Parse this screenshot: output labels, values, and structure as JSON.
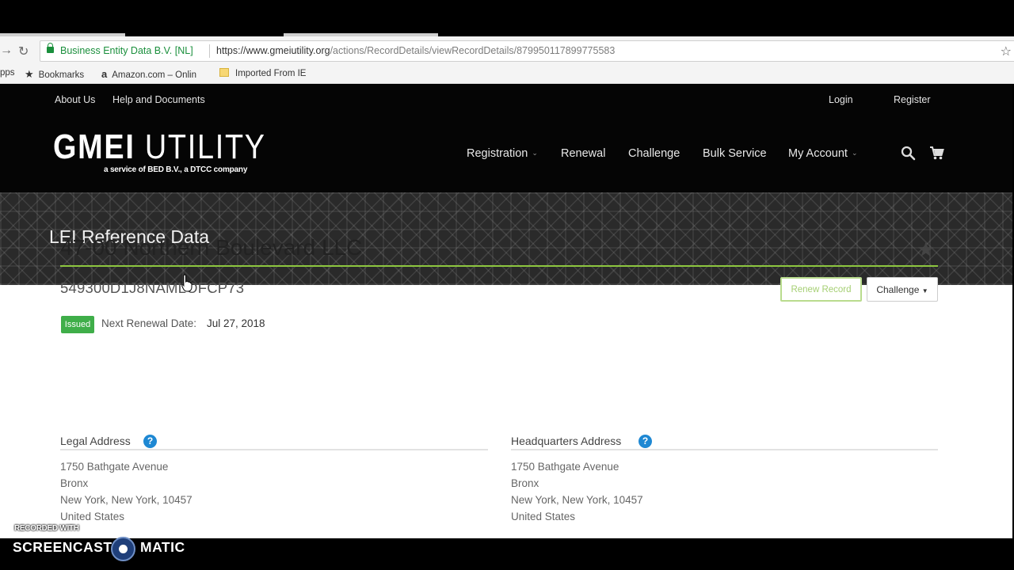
{
  "browser": {
    "omnibox": {
      "org": "Business Entity Data B.V. [NL]",
      "url_host": "https://www.gmeiutility.org",
      "url_path": "/actions/RecordDetails/viewRecordDetails/879950117899775583"
    },
    "bookmarks": [
      "pps",
      "Bookmarks",
      "Amazon.com – Onlin",
      "Imported From IE"
    ]
  },
  "site": {
    "util_links": {
      "about": "About Us",
      "help": "Help and Documents",
      "login": "Login",
      "register": "Register"
    },
    "logo": {
      "bold": "GMEI",
      "light": "UTILITY",
      "subtitle": "a service of BED B.V., a DTCC company"
    },
    "nav": {
      "registration": "Registration",
      "renewal": "Renewal",
      "challenge": "Challenge",
      "bulk": "Bulk Service",
      "account": "My Account"
    },
    "banner_title": "LEI Reference Data"
  },
  "record": {
    "entity_name": "47-00 Northern Boulevard LLC",
    "lei": "549300D1J8NAMLOFCP73",
    "renew_button": "Renew Record",
    "challenge_button": "Challenge",
    "status": "Issued",
    "next_renewal_label": "Next Renewal Date:",
    "next_renewal_value": "Jul 27, 2018",
    "legal_address": {
      "heading": "Legal Address",
      "lines": [
        "1750 Bathgate Avenue",
        "Bronx",
        "New York, New York, 10457",
        "United States"
      ]
    },
    "hq_address": {
      "heading": "Headquarters Address",
      "lines": [
        "1750 Bathgate Avenue",
        "Bronx",
        "New York, New York, 10457",
        "United States"
      ]
    }
  },
  "overlay": {
    "recorded_with": "RECORDED WITH",
    "brand_left": "SCREENCAST",
    "brand_right": "MATIC"
  },
  "colors": {
    "accent_green": "#8dc63f",
    "status_green": "#3fae49",
    "help_blue": "#1e88d3",
    "header_black": "#050505"
  }
}
